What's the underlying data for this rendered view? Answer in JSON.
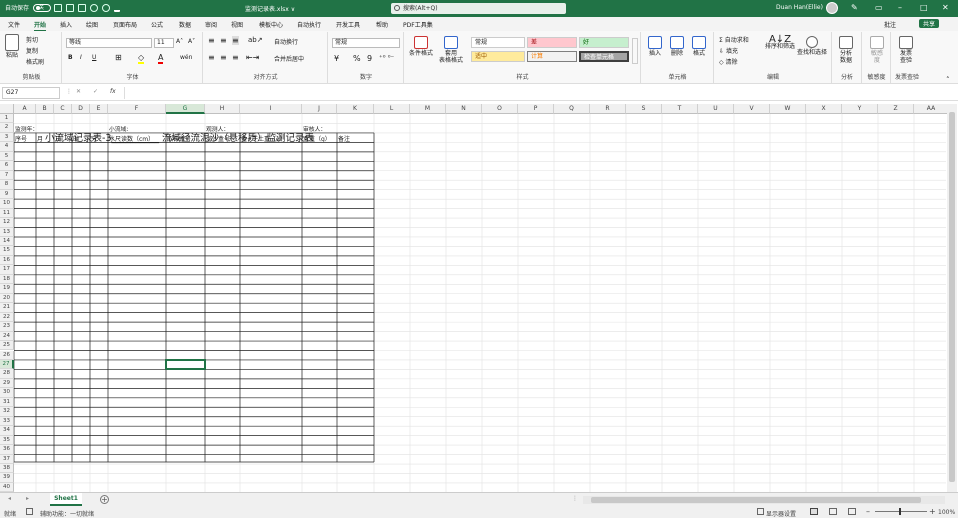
{
  "titlebar": {
    "autosave_label": "自动保存",
    "toggle_state": "关",
    "filename": "监测记录表.xlsx ∨",
    "search_placeholder": "搜索(Alt+Q)",
    "user_name": "Duan Han(Ellie)",
    "win_min": "–",
    "win_max": "□",
    "win_close": "✕",
    "pen_icon": "✎",
    "layout_icon": "▭"
  },
  "menus": [
    "文件",
    "开始",
    "插入",
    "绘图",
    "页面布局",
    "公式",
    "数据",
    "审阅",
    "视图",
    "模板中心",
    "自动执行",
    "开发工具",
    "帮助",
    "PDF工具集"
  ],
  "menu_active_index": 1,
  "share": {
    "comment": "批注",
    "share": "共享"
  },
  "ribbon": {
    "clipboard": {
      "paste": "粘贴",
      "cut": "剪切",
      "copy": "复制",
      "format_painter": "格式刷",
      "label": "剪贴板"
    },
    "font": {
      "name": "等线",
      "size": "11",
      "grow": "A˄",
      "shrink": "A˅",
      "bold": "B",
      "italic": "I",
      "underline": "U",
      "border": "⊞",
      "fill": "◇",
      "color": "A",
      "phonetic": "wén",
      "label": "字体"
    },
    "align": {
      "wrap": "自动换行",
      "merge": "合并后居中",
      "label": "对齐方式"
    },
    "number": {
      "format": "常规",
      "currency": "¥",
      "percent": "%",
      "comma": "9",
      "label": "数字"
    },
    "styles": {
      "cond": "条件格式",
      "table": "套用\n表格格式",
      "normal": "常规",
      "bad": "差",
      "good": "好",
      "neutral": "适中",
      "calc": "计算",
      "check": "检查单元格",
      "label": "样式"
    },
    "cells": {
      "insert": "插入",
      "delete": "删除",
      "format": "格式",
      "label": "单元格"
    },
    "editing": {
      "autosum": "自动求和",
      "fill": "填充",
      "clear": "清除",
      "sort": "排序和筛选",
      "find": "查找和选择",
      "label": "编辑"
    },
    "analysis": {
      "btn": "分析\n数据",
      "label": "分析"
    },
    "sensitivity": {
      "btn": "敏感\n度",
      "label": "敏感度"
    },
    "invoice": {
      "btn": "发票\n查验",
      "label": "发票查验"
    }
  },
  "formula": {
    "namebox": "G27",
    "cancel": "✕",
    "enter": "✓",
    "fx": "fx",
    "content": ""
  },
  "columns": [
    "A",
    "B",
    "C",
    "D",
    "E",
    "F",
    "G",
    "H",
    "I",
    "J",
    "K",
    "L",
    "M",
    "N",
    "O",
    "P",
    "Q",
    "R",
    "S",
    "T",
    "U",
    "V",
    "W",
    "X",
    "Y",
    "Z",
    "AA"
  ],
  "selected_col": "G",
  "selected_row": 27,
  "sheet": {
    "title": "小流域记录表-3__________ 流域径流泥沙（悬移质）监测记录表",
    "row2": {
      "A": "监测年：",
      "F": "小流域:",
      "H": "观测人：",
      "J": "审核人："
    },
    "headers": [
      "序号",
      "月",
      "日",
      "时",
      "分",
      "水尺读数（cm）",
      "取样瓶号",
      "泥沙盒号",
      "盒+干土重（g）",
      "盒重（g）",
      "备注"
    ]
  },
  "tabs": {
    "sheet1": "Sheet1",
    "add": "+"
  },
  "status": {
    "ready": "就绪",
    "accessibility": "辅助功能：一切就绪",
    "display": "显示器设置",
    "zoom": "100%"
  }
}
